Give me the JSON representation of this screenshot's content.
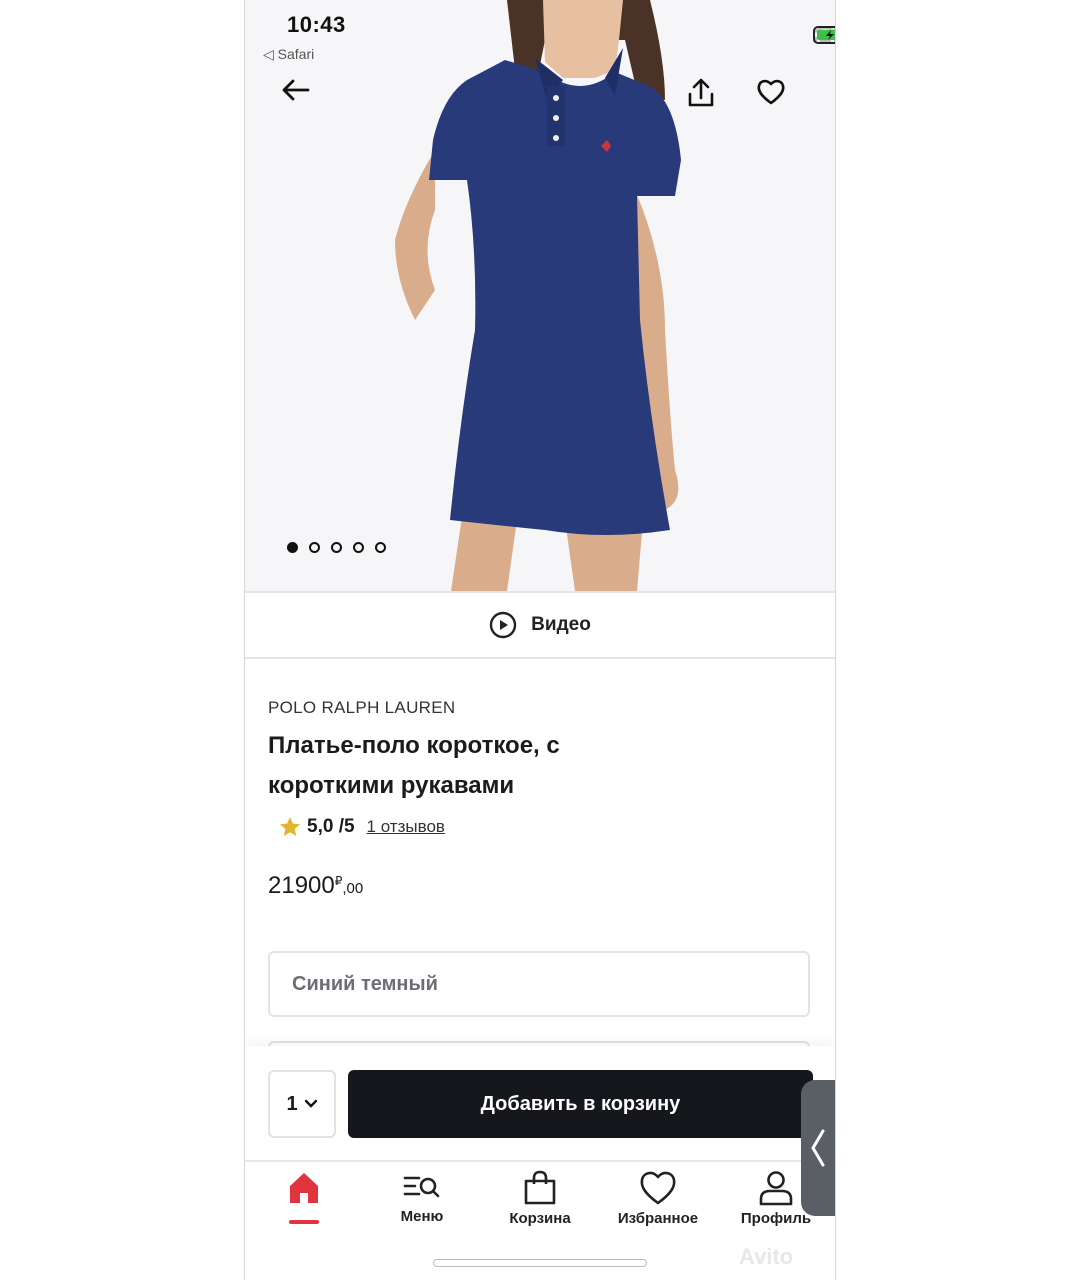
{
  "status_bar": {
    "time": "10:43",
    "back_app": "◁ Safari"
  },
  "gallery": {
    "dots_total": 5,
    "active_dot": 0
  },
  "video": {
    "label": "Видео"
  },
  "product": {
    "brand": "POLO RALPH LAUREN",
    "title": "Платье-поло короткое, с короткими рукавами",
    "rating": "5,0 /5",
    "reviews": "1 отзывов",
    "price_main": "21900",
    "currency": "₽",
    "price_cents": ",00"
  },
  "color_select": {
    "value": "Синий темный"
  },
  "cart": {
    "quantity": "1",
    "add_button": "Добавить в корзину"
  },
  "tabs": [
    {
      "label": "",
      "icon": "home-icon",
      "active": true
    },
    {
      "label": "Меню",
      "icon": "menu-search-icon"
    },
    {
      "label": "Корзина",
      "icon": "bag-icon"
    },
    {
      "label": "Избранное",
      "icon": "heart-icon"
    },
    {
      "label": "Профиль",
      "icon": "profile-icon"
    }
  ],
  "watermark": "Avito",
  "colors": {
    "accent": "#e0343e",
    "button": "#15171c",
    "dress": "#283a7a",
    "star": "#e3b32a"
  }
}
